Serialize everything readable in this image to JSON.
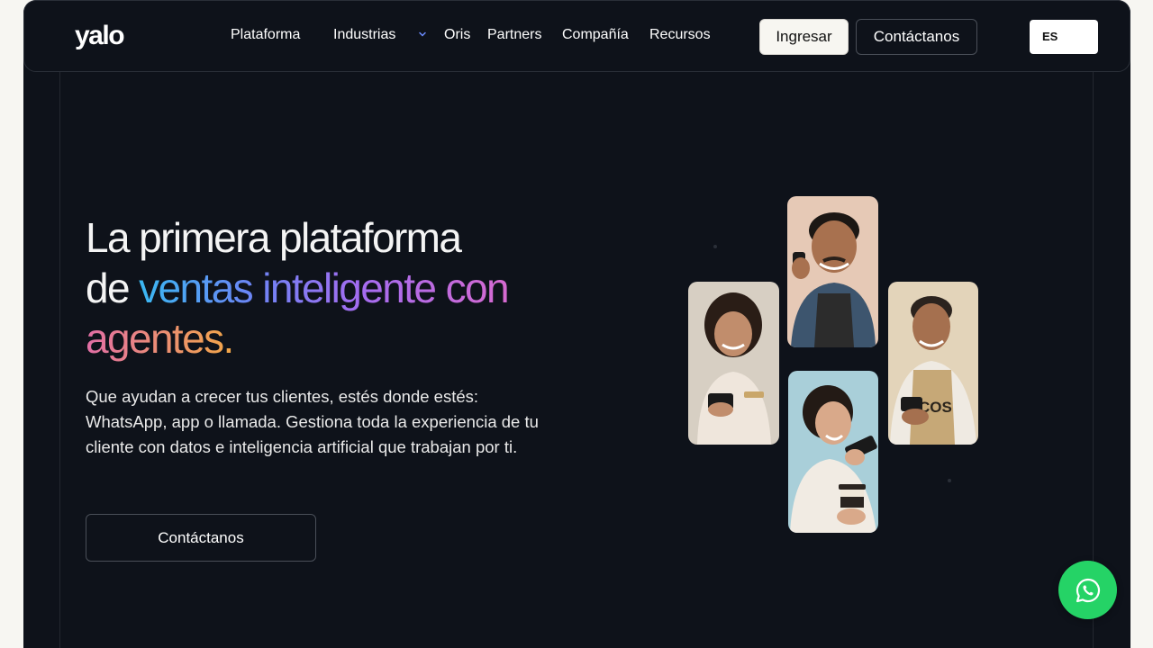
{
  "brand": {
    "logo_text": "yalo"
  },
  "nav": {
    "items": [
      {
        "label": "Plataforma"
      },
      {
        "label": "Industrias"
      },
      {
        "label": "Oris"
      },
      {
        "label": "Partners"
      },
      {
        "label": "Compañía"
      },
      {
        "label": "Recursos"
      }
    ],
    "login_label": "Ingresar",
    "contact_label": "Contáctanos",
    "language": "ES"
  },
  "hero": {
    "headline_line1": "La primera plataforma",
    "headline_line2_plain": "de ",
    "headline_line2_grad": "ventas inteligente con",
    "headline_line3_grad": "agentes.",
    "subtext": "Que ayudan a crecer tus clientes, estés donde estés: WhatsApp, app o llamada. Gestiona toda la experiencia de tu cliente con datos e inteligencia artificial que trabajan por ti.",
    "cta_label": "Contáctanos"
  },
  "colors": {
    "background": "#0e121a",
    "page": "#f7f6f2",
    "whatsapp": "#25d366"
  },
  "icons": {
    "chevron": "chevron-down-icon",
    "whatsapp": "whatsapp-icon"
  }
}
